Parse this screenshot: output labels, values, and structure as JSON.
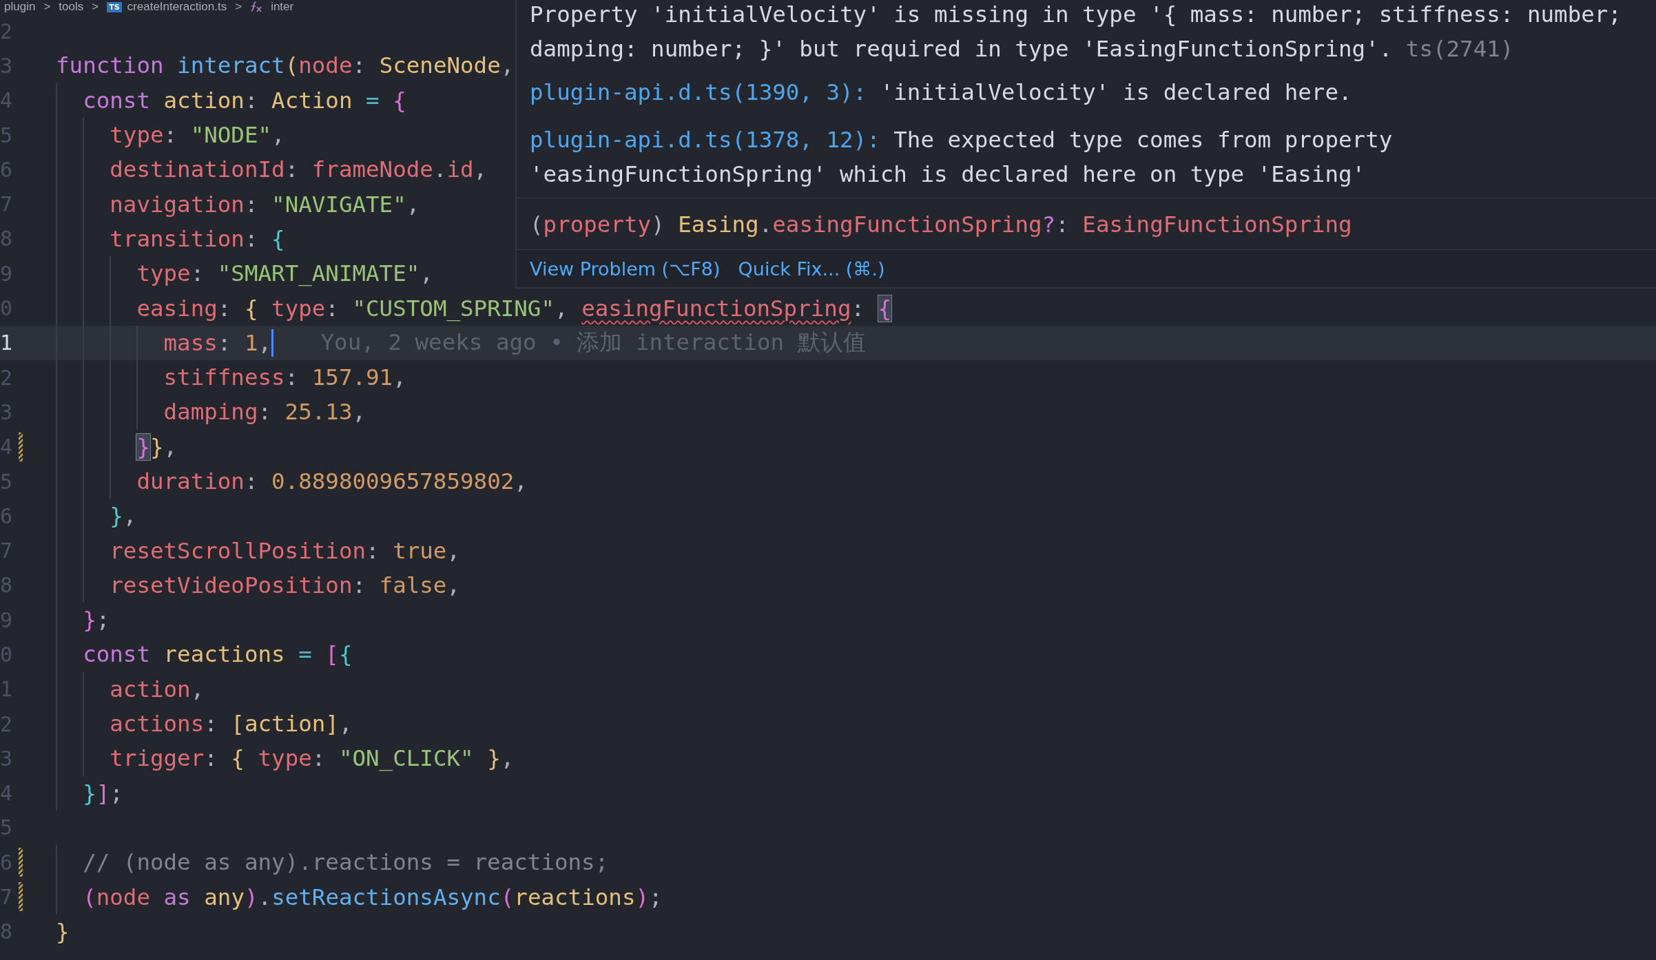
{
  "breadcrumb": {
    "items": [
      {
        "kind": "folder",
        "text": "plugin"
      },
      {
        "kind": "folder",
        "text": "tools"
      },
      {
        "kind": "file",
        "badge": "TS",
        "text": "createInteraction.ts"
      },
      {
        "kind": "symbol",
        "text": "inter"
      }
    ],
    "separator": ">"
  },
  "editor": {
    "lines": [
      {
        "number": "2",
        "current": false,
        "modified": false
      },
      {
        "number": "3",
        "current": false,
        "modified": false,
        "tokens": [
          {
            "kind": "kw",
            "text": "function "
          },
          {
            "kind": "fn",
            "text": "interact"
          },
          {
            "kind": "b1",
            "text": "("
          },
          {
            "kind": "prop",
            "text": "node"
          },
          {
            "kind": "punc",
            "text": ": "
          },
          {
            "kind": "type",
            "text": "SceneNode"
          },
          {
            "kind": "punc",
            "text": ","
          }
        ]
      },
      {
        "number": "4",
        "current": false,
        "modified": false,
        "tokens": [
          {
            "kind": "kw",
            "text": "  const "
          },
          {
            "kind": "type",
            "text": "action"
          },
          {
            "kind": "punc",
            "text": ": "
          },
          {
            "kind": "type",
            "text": "Action"
          },
          {
            "kind": "op",
            "text": " = "
          },
          {
            "kind": "b2",
            "text": "{"
          }
        ]
      },
      {
        "number": "5",
        "current": false,
        "modified": false,
        "tokens": [
          {
            "kind": "prop",
            "text": "    type"
          },
          {
            "kind": "punc",
            "text": ": "
          },
          {
            "kind": "str",
            "text": "\"NODE\""
          },
          {
            "kind": "punc",
            "text": ","
          }
        ]
      },
      {
        "number": "6",
        "current": false,
        "modified": false,
        "tokens": [
          {
            "kind": "prop",
            "text": "    destinationId"
          },
          {
            "kind": "punc",
            "text": ": "
          },
          {
            "kind": "prop",
            "text": "frameNode"
          },
          {
            "kind": "punc",
            "text": "."
          },
          {
            "kind": "prop",
            "text": "id"
          },
          {
            "kind": "punc",
            "text": ","
          }
        ]
      },
      {
        "number": "7",
        "current": false,
        "modified": false,
        "tokens": [
          {
            "kind": "prop",
            "text": "    navigation"
          },
          {
            "kind": "punc",
            "text": ": "
          },
          {
            "kind": "str",
            "text": "\"NAVIGATE\""
          },
          {
            "kind": "punc",
            "text": ","
          }
        ]
      },
      {
        "number": "8",
        "current": false,
        "modified": false,
        "tokens": [
          {
            "kind": "prop",
            "text": "    transition"
          },
          {
            "kind": "punc",
            "text": ": "
          },
          {
            "kind": "b3",
            "text": "{"
          }
        ]
      },
      {
        "number": "9",
        "current": false,
        "modified": false,
        "tokens": [
          {
            "kind": "prop",
            "text": "      type"
          },
          {
            "kind": "punc",
            "text": ": "
          },
          {
            "kind": "str",
            "text": "\"SMART_ANIMATE\""
          },
          {
            "kind": "punc",
            "text": ","
          }
        ]
      },
      {
        "number": "0",
        "current": false,
        "modified": false,
        "tokens": [
          {
            "kind": "prop",
            "text": "      easing"
          },
          {
            "kind": "punc",
            "text": ": "
          },
          {
            "kind": "b1",
            "text": "{ "
          },
          {
            "kind": "prop",
            "text": "type"
          },
          {
            "kind": "punc",
            "text": ": "
          },
          {
            "kind": "str",
            "text": "\"CUSTOM_SPRING\""
          },
          {
            "kind": "punc",
            "text": ", "
          },
          {
            "kind": "prop",
            "text": "easingFunctionSpring",
            "error": true
          },
          {
            "kind": "punc",
            "text": ": "
          },
          {
            "kind": "b2",
            "text": "{",
            "match": true
          }
        ]
      },
      {
        "number": "1",
        "current": true,
        "modified": false,
        "blame": "You, 2 weeks ago • 添加 interaction 默认值",
        "tokens": [
          {
            "kind": "prop",
            "text": "        mass"
          },
          {
            "kind": "punc",
            "text": ": "
          },
          {
            "kind": "num",
            "text": "1"
          },
          {
            "kind": "punc",
            "text": ","
          }
        ]
      },
      {
        "number": "2",
        "current": false,
        "modified": false,
        "tokens": [
          {
            "kind": "prop",
            "text": "        stiffness"
          },
          {
            "kind": "punc",
            "text": ": "
          },
          {
            "kind": "num",
            "text": "157.91"
          },
          {
            "kind": "punc",
            "text": ","
          }
        ]
      },
      {
        "number": "3",
        "current": false,
        "modified": false,
        "tokens": [
          {
            "kind": "prop",
            "text": "        damping"
          },
          {
            "kind": "punc",
            "text": ": "
          },
          {
            "kind": "num",
            "text": "25.13"
          },
          {
            "kind": "punc",
            "text": ","
          }
        ]
      },
      {
        "number": "4",
        "current": false,
        "modified": true,
        "tokens": [
          {
            "kind": "b2",
            "text": "      }",
            "match": true
          },
          {
            "kind": "b1",
            "text": "}"
          },
          {
            "kind": "punc",
            "text": ","
          }
        ]
      },
      {
        "number": "5",
        "current": false,
        "modified": false,
        "tokens": [
          {
            "kind": "prop",
            "text": "      duration"
          },
          {
            "kind": "punc",
            "text": ": "
          },
          {
            "kind": "num",
            "text": "0.8898009657859802"
          },
          {
            "kind": "punc",
            "text": ","
          }
        ]
      },
      {
        "number": "6",
        "current": false,
        "modified": false,
        "tokens": [
          {
            "kind": "b3",
            "text": "    }"
          },
          {
            "kind": "punc",
            "text": ","
          }
        ]
      },
      {
        "number": "7",
        "current": false,
        "modified": false,
        "tokens": [
          {
            "kind": "prop",
            "text": "    resetScrollPosition"
          },
          {
            "kind": "punc",
            "text": ": "
          },
          {
            "kind": "num",
            "text": "true"
          },
          {
            "kind": "punc",
            "text": ","
          }
        ]
      },
      {
        "number": "8",
        "current": false,
        "modified": false,
        "tokens": [
          {
            "kind": "prop",
            "text": "    resetVideoPosition"
          },
          {
            "kind": "punc",
            "text": ": "
          },
          {
            "kind": "num",
            "text": "false"
          },
          {
            "kind": "punc",
            "text": ","
          }
        ]
      },
      {
        "number": "9",
        "current": false,
        "modified": false,
        "tokens": [
          {
            "kind": "b2",
            "text": "  }"
          },
          {
            "kind": "punc",
            "text": ";"
          }
        ]
      },
      {
        "number": "0",
        "current": false,
        "modified": false,
        "tokens": [
          {
            "kind": "kw",
            "text": "  const "
          },
          {
            "kind": "type",
            "text": "reactions"
          },
          {
            "kind": "op",
            "text": " = "
          },
          {
            "kind": "b2",
            "text": "["
          },
          {
            "kind": "b3",
            "text": "{"
          }
        ]
      },
      {
        "number": "1",
        "current": false,
        "modified": false,
        "tokens": [
          {
            "kind": "prop",
            "text": "    action"
          },
          {
            "kind": "punc",
            "text": ","
          }
        ]
      },
      {
        "number": "2",
        "current": false,
        "modified": false,
        "tokens": [
          {
            "kind": "prop",
            "text": "    actions"
          },
          {
            "kind": "punc",
            "text": ": "
          },
          {
            "kind": "b1",
            "text": "["
          },
          {
            "kind": "type",
            "text": "action"
          },
          {
            "kind": "b1",
            "text": "]"
          },
          {
            "kind": "punc",
            "text": ","
          }
        ]
      },
      {
        "number": "3",
        "current": false,
        "modified": false,
        "tokens": [
          {
            "kind": "prop",
            "text": "    trigger"
          },
          {
            "kind": "punc",
            "text": ": "
          },
          {
            "kind": "b1",
            "text": "{ "
          },
          {
            "kind": "prop",
            "text": "type"
          },
          {
            "kind": "punc",
            "text": ": "
          },
          {
            "kind": "str",
            "text": "\"ON_CLICK\""
          },
          {
            "kind": "b1",
            "text": " }"
          },
          {
            "kind": "punc",
            "text": ","
          }
        ]
      },
      {
        "number": "4",
        "current": false,
        "modified": false,
        "tokens": [
          {
            "kind": "b3",
            "text": "  }"
          },
          {
            "kind": "b2",
            "text": "]"
          },
          {
            "kind": "punc",
            "text": ";"
          }
        ]
      },
      {
        "number": "5",
        "current": false,
        "modified": false
      },
      {
        "number": "6",
        "current": false,
        "modified": true,
        "tokens": [
          {
            "kind": "comment",
            "text": "  // (node as any).reactions = reactions;"
          }
        ]
      },
      {
        "number": "7",
        "current": false,
        "modified": true,
        "tokens": [
          {
            "kind": "b2",
            "text": "  ("
          },
          {
            "kind": "prop",
            "text": "node"
          },
          {
            "kind": "kw",
            "text": " as "
          },
          {
            "kind": "type",
            "text": "any"
          },
          {
            "kind": "b2",
            "text": ")"
          },
          {
            "kind": "punc",
            "text": "."
          },
          {
            "kind": "fn",
            "text": "setReactionsAsync"
          },
          {
            "kind": "b2",
            "text": "("
          },
          {
            "kind": "type",
            "text": "reactions"
          },
          {
            "kind": "b2",
            "text": ")"
          },
          {
            "kind": "punc",
            "text": ";"
          }
        ]
      },
      {
        "number": "8",
        "current": false,
        "modified": false,
        "tokens": [
          {
            "kind": "b1",
            "text": "}"
          }
        ]
      }
    ]
  },
  "hover": {
    "message": "Property 'initialVelocity' is missing in type '{ mass: number; stiffness: number; damping: number; }' but required in type 'EasingFunctionSpring'.",
    "code": "ts(2741)",
    "related": [
      {
        "location": "plugin-api.d.ts(1390, 3):",
        "text": "'initialVelocity' is declared here."
      },
      {
        "location": "plugin-api.d.ts(1378, 12):",
        "text": "The expected type comes from property 'easingFunctionSpring' which is declared here on type 'Easing'"
      }
    ],
    "signature": [
      {
        "kind": "punc",
        "text": "("
      },
      {
        "kind": "prop",
        "text": "property"
      },
      {
        "kind": "punc",
        "text": ") "
      },
      {
        "kind": "type",
        "text": "Easing"
      },
      {
        "kind": "punc",
        "text": "."
      },
      {
        "kind": "prop",
        "text": "easingFunctionSpring"
      },
      {
        "kind": "kw",
        "text": "?"
      },
      {
        "kind": "punc",
        "text": ": "
      },
      {
        "kind": "prop",
        "text": "EasingFunctionSpring"
      }
    ],
    "actions": [
      "View Problem (⌥F8)",
      "Quick Fix... (⌘.)"
    ]
  }
}
